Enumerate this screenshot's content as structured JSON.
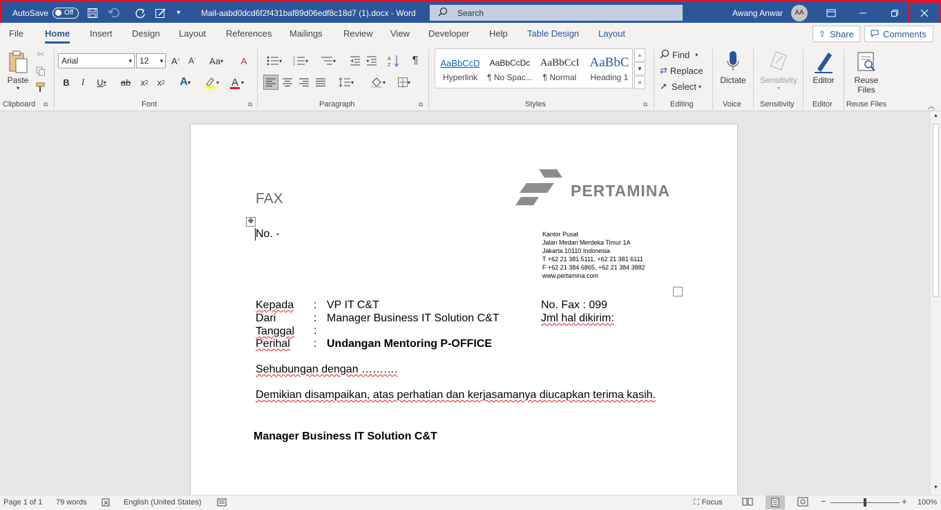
{
  "titlebar": {
    "autosave_label": "AutoSave",
    "autosave_state": "Off",
    "doc_title": "Mail-aabd0dcd6f2f431baf89d06edf8c18d7 (1).docx  -  Word",
    "search_placeholder": "Search",
    "user_name": "Awang Anwar",
    "user_initials": "AA"
  },
  "tabs": {
    "file": "File",
    "home": "Home",
    "insert": "Insert",
    "design": "Design",
    "layout": "Layout",
    "references": "References",
    "mailings": "Mailings",
    "review": "Review",
    "view": "View",
    "developer": "Developer",
    "help": "Help",
    "table_design": "Table Design",
    "table_layout": "Layout",
    "share": "Share",
    "comments": "Comments"
  },
  "ribbon": {
    "paste": "Paste",
    "font_name": "Arial",
    "font_size": "12",
    "styles": [
      {
        "sample": "AaBbCcD",
        "name": "Hyperlink"
      },
      {
        "sample": "AaBbCcDc",
        "name": "¶ No Spac..."
      },
      {
        "sample": "AaBbCcI",
        "name": "¶ Normal"
      },
      {
        "sample": "AaBbC",
        "name": "Heading 1"
      }
    ],
    "find": "Find",
    "replace": "Replace",
    "select": "Select",
    "dictate": "Dictate",
    "sensitivity": "Sensitivity",
    "editor": "Editor",
    "reuse_files_1": "Reuse",
    "reuse_files_2": "Files",
    "groups": {
      "clipboard": "Clipboard",
      "font": "Font",
      "paragraph": "Paragraph",
      "styles": "Styles",
      "editing": "Editing",
      "voice": "Voice",
      "sensitivity": "Sensitivity",
      "editor": "Editor",
      "reuse_files": "Reuse Files"
    }
  },
  "document": {
    "fax_title": "FAX",
    "logo_text": "PERTAMINA",
    "number": "No. -",
    "address": [
      "Kantor Pusat",
      "Jalan Medan Merdeka Timur 1A",
      "Jakarta 10110 Indonesia",
      "T +62 21 381 5111, +62 21 381 6111",
      "F +62 21 384 6865, +62 21 384 3882",
      "www.pertamina.com"
    ],
    "fields": [
      {
        "label": "Kepada",
        "colon": ":",
        "value": "VP IT C&T"
      },
      {
        "label": "Dari",
        "colon": ":",
        "value": "Manager Business IT Solution C&T"
      },
      {
        "label": "Tanggal",
        "colon": ":",
        "value": ""
      },
      {
        "label": "Perihal",
        "colon": ":",
        "value": "Undangan Mentoring P-OFFICE"
      }
    ],
    "fax_no": "No. Fax : 099",
    "jml_hal": "Jml hal dikirim:",
    "para1": "Sehubungan dengan ……….",
    "para2": "Demikian disampaikan, atas perhatian dan kerjasamanya diucapkan terima kasih.",
    "signature": "Manager Business IT Solution C&T"
  },
  "status": {
    "page": "Page 1 of 1",
    "words": "79 words",
    "language": "English (United States)",
    "focus": "Focus",
    "zoom": "100%"
  },
  "colors": {
    "accent": "#2b579a",
    "close_highlight": "#e81123"
  }
}
